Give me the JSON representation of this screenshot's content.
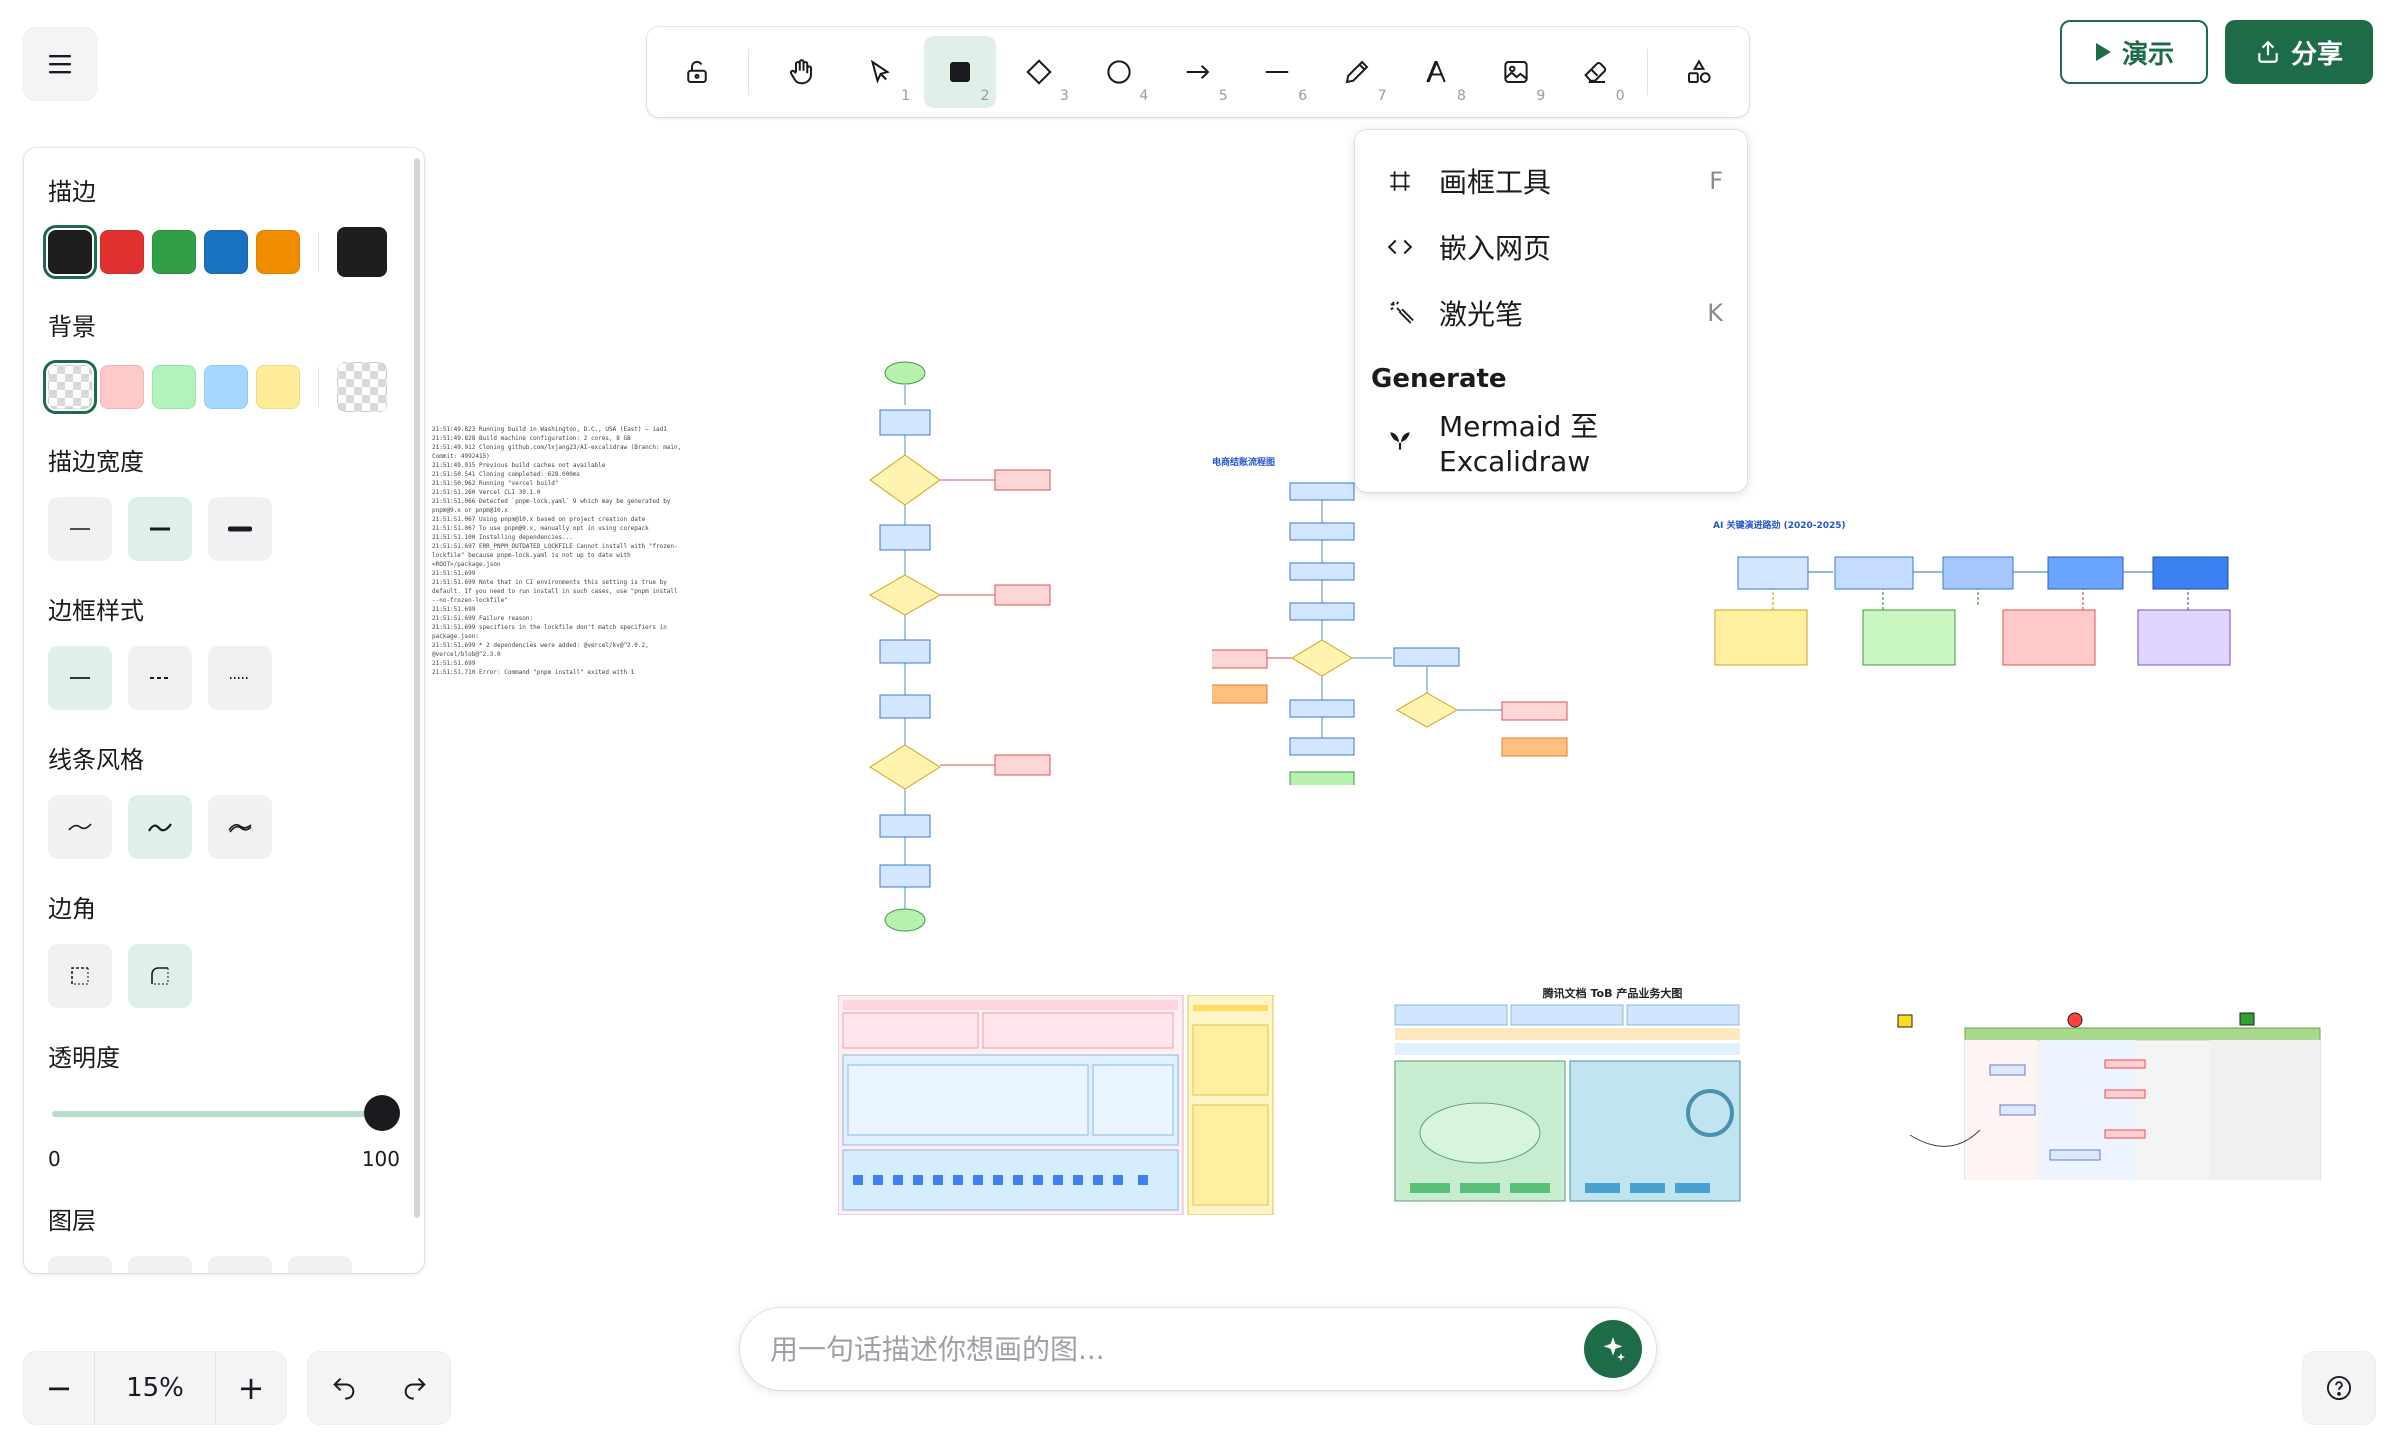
{
  "toolbar": {
    "tools": [
      {
        "name": "lock",
        "key": ""
      },
      {
        "name": "hand",
        "key": ""
      },
      {
        "name": "select",
        "key": "1"
      },
      {
        "name": "rectangle",
        "key": "2"
      },
      {
        "name": "diamond",
        "key": "3"
      },
      {
        "name": "ellipse",
        "key": "4"
      },
      {
        "name": "arrow",
        "key": "5"
      },
      {
        "name": "line",
        "key": "6"
      },
      {
        "name": "pencil",
        "key": "7"
      },
      {
        "name": "text",
        "key": "8"
      },
      {
        "name": "image",
        "key": "9"
      },
      {
        "name": "eraser",
        "key": "0"
      },
      {
        "name": "more-shapes",
        "key": ""
      }
    ],
    "active_tool": "rectangle"
  },
  "header": {
    "present_label": "演示",
    "share_label": "分享"
  },
  "dropdown": {
    "items": [
      {
        "icon": "frame-icon",
        "label": "画框工具",
        "shortcut": "F"
      },
      {
        "icon": "embed-icon",
        "label": "嵌入网页",
        "shortcut": ""
      },
      {
        "icon": "laser-icon",
        "label": "激光笔",
        "shortcut": "K"
      }
    ],
    "group_title": "Generate",
    "generate_items": [
      {
        "icon": "mermaid-icon",
        "label": "Mermaid 至 Excalidraw"
      }
    ]
  },
  "panel": {
    "stroke_title": "描边",
    "stroke_colors": [
      "#1e1e1e",
      "#e03131",
      "#2f9e44",
      "#1971c2",
      "#f08c00"
    ],
    "stroke_current": "#1e1e1e",
    "background_title": "背景",
    "background_colors": [
      "transparent",
      "#ffc9c9",
      "#b2f2bb",
      "#a5d8ff",
      "#ffec99"
    ],
    "background_current": "transparent",
    "stroke_width_title": "描边宽度",
    "stroke_style_title": "边框样式",
    "sloppiness_title": "线条风格",
    "edges_title": "边角",
    "opacity_title": "透明度",
    "opacity_min": "0",
    "opacity_max": "100",
    "opacity_value": 100,
    "layers_title": "图层"
  },
  "zoom": {
    "minus": "−",
    "value": "15%",
    "plus": "+"
  },
  "prompt": {
    "placeholder": "用一句话描述你想画的图..."
  },
  "canvas": {
    "log_lines": [
      "21:51:49.823 Running build in Washington, D.C., USA (East) – iad1",
      "21:51:49.828 Build machine configuration: 2 cores, 8 GB",
      "21:51:49.912 Cloning github.com/lxjang23/AI-excalidraw (Branch: main, Commit: 4992415)",
      "21:51:49.915 Previous build caches not available",
      "21:51:50.541 Cloning completed: 628.000ms",
      "21:51:50.962 Running \"vercel build\"",
      "21:51:51.260 Vercel CLI 39.1.0",
      "21:51:51.066 Detected `pnpm-lock.yaml` 9 which may be generated by pnpm@9.x or pnpm@10.x",
      "21:51:51.067 Using pnpm@10.x based on project creation date",
      "21:51:51.067 To use pnpm@9.x, manually opt in using corepack",
      "21:51:51.100 Installing dependencies...",
      "21:51:51.697 ERR_PNPM_OUTDATED_LOCKFILE Cannot install with \"frozen-lockfile\" because pnpm-lock.yaml is not up to date with <ROOT>/package.json",
      "21:51:51.699",
      "21:51:51.699 Note that in CI environments this setting is true by default. If you need to run install in such cases, use \"pnpm install --no-frozen-lockfile\"",
      "21:51:51.699",
      "21:51:51.699   Failure reason:",
      "21:51:51.699   specifiers in the lockfile don't match specifiers in package.json:",
      "21:51:51.699 * 2 dependencies were added: @vercel/kv@^2.0.2, @vercel/blob@^2.3.0",
      "21:51:51.699",
      "21:51:51.710 Error: Command \"pnpm install\" exited with 1"
    ],
    "flow2_title": "电商结账流程图",
    "roadmap_title": "AI 关键演进路劲 (2020-2025)",
    "product_map_title": "腾讯文档 ToB 产品业务大图"
  }
}
